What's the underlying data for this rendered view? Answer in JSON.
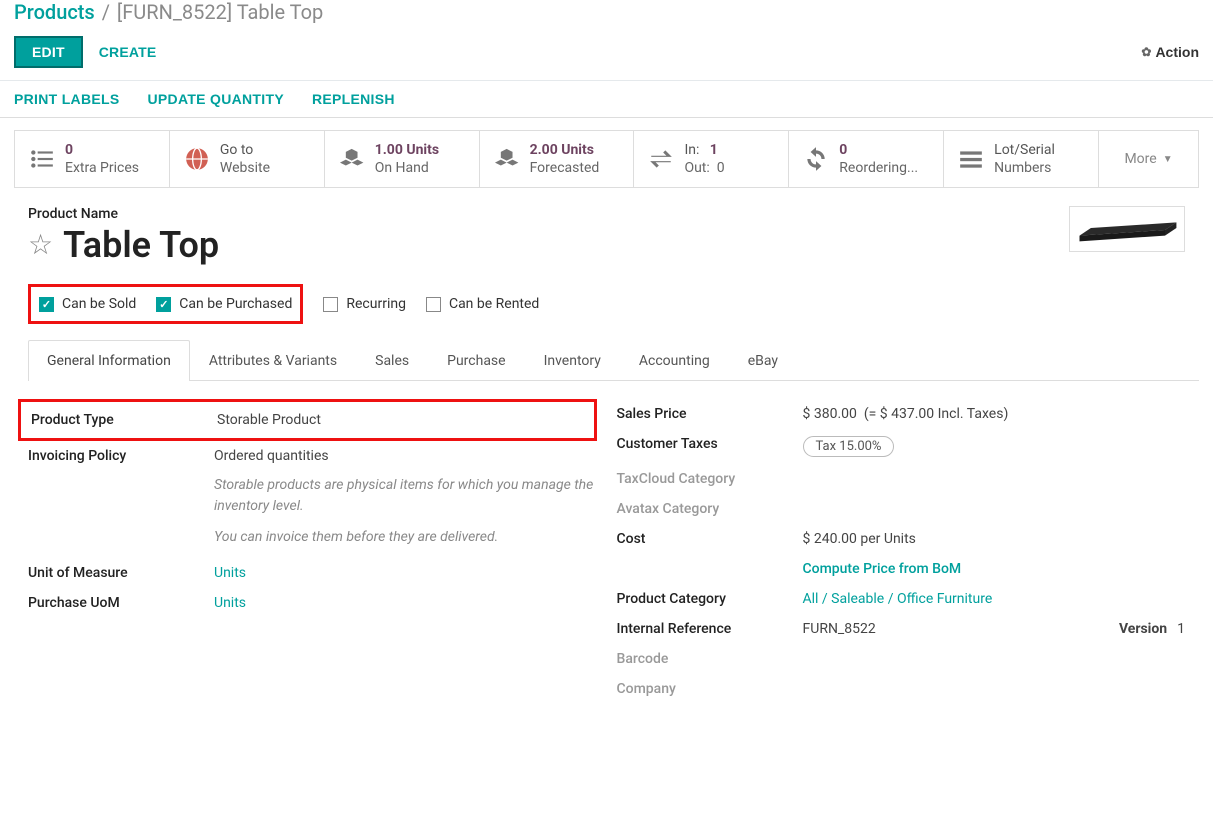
{
  "breadcrumb": {
    "parent": "Products",
    "sep": "/",
    "current": "[FURN_8522] Table Top"
  },
  "toolbar": {
    "edit": "EDIT",
    "create": "CREATE",
    "action": "Action"
  },
  "toolbar2": {
    "print_labels": "PRINT LABELS",
    "update_qty": "UPDATE QUANTITY",
    "replenish": "REPLENISH"
  },
  "stats": {
    "extra_prices": {
      "n": "0",
      "label": "Extra Prices"
    },
    "website": {
      "l1": "Go to",
      "l2": "Website"
    },
    "on_hand": {
      "n": "1.00 Units",
      "label": "On Hand"
    },
    "forecasted": {
      "n": "2.00 Units",
      "label": "Forecasted"
    },
    "in": {
      "label": "In:",
      "n": "1"
    },
    "out": {
      "label": "Out:",
      "n": "0"
    },
    "reorder": {
      "n": "0",
      "label": "Reordering..."
    },
    "lot": {
      "l1": "Lot/Serial",
      "l2": "Numbers"
    },
    "more": "More"
  },
  "product": {
    "name_label": "Product Name",
    "name": "Table Top"
  },
  "checkboxes": {
    "sold": "Can be Sold",
    "purchased": "Can be Purchased",
    "recurring": "Recurring",
    "rented": "Can be Rented"
  },
  "tabs": {
    "general": "General Information",
    "attrs": "Attributes & Variants",
    "sales": "Sales",
    "purchase": "Purchase",
    "inventory": "Inventory",
    "accounting": "Accounting",
    "ebay": "eBay"
  },
  "left_col": {
    "product_type_label": "Product Type",
    "product_type": "Storable Product",
    "inv_policy_label": "Invoicing Policy",
    "inv_policy": "Ordered quantities",
    "help1": "Storable products are physical items for which you manage the inventory level.",
    "help2": "You can invoice them before they are delivered.",
    "uom_label": "Unit of Measure",
    "uom": "Units",
    "puom_label": "Purchase UoM",
    "puom": "Units"
  },
  "right_col": {
    "sales_price_label": "Sales Price",
    "sales_price_val": "$ 380.00",
    "sales_price_incl": "(= $ 437.00 Incl. Taxes)",
    "cust_tax_label": "Customer Taxes",
    "cust_tax_val": "Tax 15.00%",
    "taxcloud_label": "TaxCloud Category",
    "avatax_label": "Avatax Category",
    "cost_label": "Cost",
    "cost_val": "$ 240.00",
    "cost_per": "per Units",
    "compute_bom": "Compute Price from BoM",
    "cat_label": "Product Category",
    "cat_val": "All / Saleable / Office Furniture",
    "ref_label": "Internal Reference",
    "ref_val": "FURN_8522",
    "version_label": "Version",
    "version_val": "1",
    "barcode_label": "Barcode",
    "company_label": "Company"
  }
}
